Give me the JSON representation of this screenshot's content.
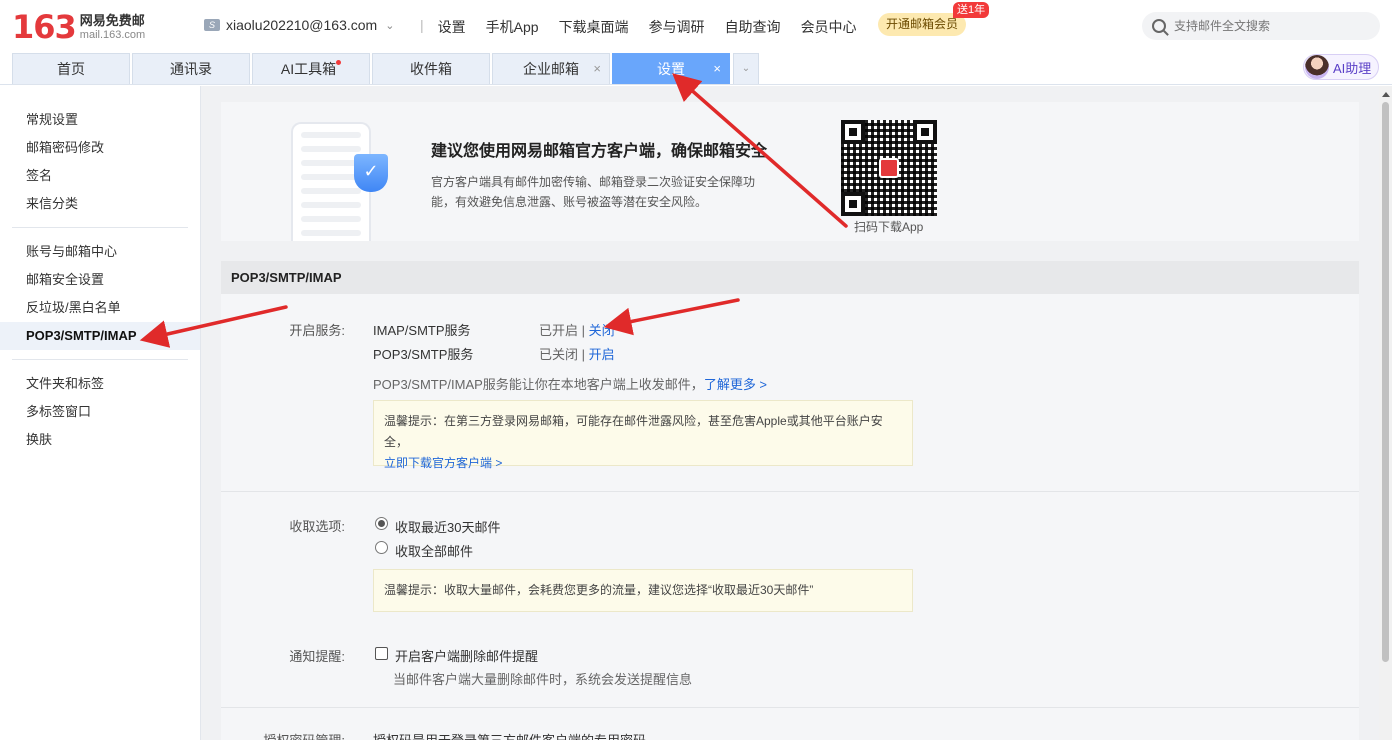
{
  "header": {
    "logo_num": "163",
    "logo_cn": "网易免费邮",
    "logo_en": "mail.163.com",
    "account": "xiaolu202210@163.com",
    "nav": [
      "设置",
      "手机App",
      "下载桌面端",
      "参与调研",
      "自助查询",
      "会员中心"
    ],
    "vip_button": "开通邮箱会员",
    "vip_badge": "送1年",
    "search_placeholder": "支持邮件全文搜索"
  },
  "tabs": [
    {
      "label": "首页"
    },
    {
      "label": "通讯录"
    },
    {
      "label": "AI工具箱"
    },
    {
      "label": "收件箱"
    },
    {
      "label": "企业邮箱"
    },
    {
      "label": "设置"
    }
  ],
  "ai_assistant": "AI助理",
  "sidebar": {
    "group1": [
      "常规设置",
      "邮箱密码修改",
      "签名",
      "来信分类"
    ],
    "group2": [
      "账号与邮箱中心",
      "邮箱安全设置",
      "反垃圾/黑白名单",
      "POP3/SMTP/IMAP"
    ],
    "group3": [
      "文件夹和标签",
      "多标签窗口",
      "换肤"
    ]
  },
  "banner": {
    "title": "建议您使用网易邮箱官方客户端，确保邮箱安全",
    "desc": "官方客户端具有邮件加密传输、邮箱登录二次验证安全保障功能，有效避免信息泄露、账号被盗等潜在安全风险。",
    "qr_label": "扫码下载App"
  },
  "section": {
    "title": "POP3/SMTP/IMAP",
    "service_label": "开启服务:",
    "services": [
      {
        "name": "IMAP/SMTP服务",
        "status": "已开启",
        "sep": " | ",
        "action": "关闭"
      },
      {
        "name": "POP3/SMTP服务",
        "status": "已关闭",
        "sep": " | ",
        "action": "开启"
      }
    ],
    "service_desc": "POP3/SMTP/IMAP服务能让你在本地客户端上收发邮件，",
    "learn_more": "了解更多 >",
    "tip1_text": "温馨提示：在第三方登录网易邮箱，可能存在邮件泄露风险，甚至危害Apple或其他平台账户安全，",
    "tip1_link": "立即下载官方客户端 >",
    "receive_label": "收取选项:",
    "receive_options": [
      "收取最近30天邮件",
      "收取全部邮件"
    ],
    "tip2_text": "温馨提示：收取大量邮件，会耗费您更多的流量，建议您选择“收取最近30天邮件”",
    "notify_label": "通知提醒:",
    "notify_option": "开启客户端删除邮件提醒",
    "notify_desc": "当邮件客户端大量删除邮件时，系统会发送提醒信息",
    "auth_label": "授权密码管理:",
    "auth_desc": "授权码是用于登录第三方邮件客户端的专用密码"
  },
  "colors": {
    "active_tab": "#69a6fb",
    "link": "#2067d8",
    "brand_red": "#e4393c",
    "annotation_arrow": "#e02a2a"
  }
}
